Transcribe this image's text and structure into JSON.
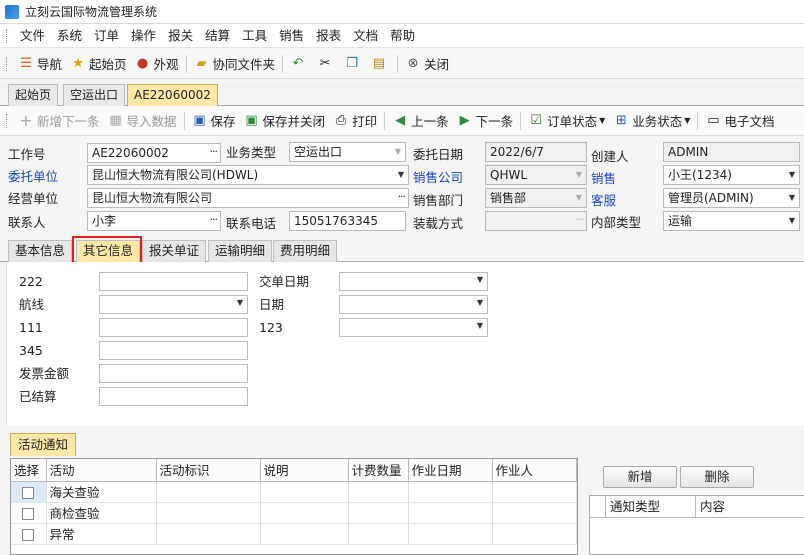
{
  "window": {
    "title": "立刻云国际物流管理系统"
  },
  "menu": [
    "文件",
    "系统",
    "订单",
    "操作",
    "报关",
    "结算",
    "工具",
    "销售",
    "报表",
    "文档",
    "帮助"
  ],
  "toolbar1": {
    "nav": "导航",
    "home": "起始页",
    "appearance": "外观",
    "shared_folder": "协同文件夹",
    "close": "关闭"
  },
  "doc_tabs": [
    "起始页",
    "空运出口",
    "AE22060002"
  ],
  "toolbar2": {
    "add_next": "新增下一条",
    "import": "导入数据",
    "save": "保存",
    "save_close": "保存并关闭",
    "print": "打印",
    "prev": "上一条",
    "next": "下一条",
    "order_status": "订单状态",
    "biz_status": "业务状态",
    "edoc": "电子文档"
  },
  "form": {
    "job_no_label": "工作号",
    "job_no": "AE22060002",
    "biz_type_label": "业务类型",
    "biz_type": "空运出口",
    "entrust_date_label": "委托日期",
    "entrust_date": "2022/6/7",
    "creator_label": "创建人",
    "creator": "ADMIN",
    "client_label": "委托单位",
    "client": "昆山恒大物流有限公司(HDWL)",
    "sales_co_label": "销售公司",
    "sales_co": "QHWL",
    "sales_label": "销售",
    "sales": "小王(1234)",
    "operator_unit_label": "经营单位",
    "operator_unit": "昆山恒大物流有限公司",
    "sales_dept_label": "销售部门",
    "sales_dept": "销售部",
    "cs_label": "客服",
    "cs": "管理员(ADMIN)",
    "contact_label": "联系人",
    "contact": "小李",
    "phone_label": "联系电话",
    "phone": "15051763345",
    "loading_label": "装载方式",
    "loading": "",
    "inner_type_label": "内部类型",
    "inner_type": "运输"
  },
  "sub_tabs": [
    "基本信息",
    "其它信息",
    "报关单证",
    "运输明细",
    "费用明细"
  ],
  "other_info": {
    "f1": "222",
    "f2": "航线",
    "f3": "111",
    "f4": "345",
    "f5": "发票金额",
    "f6": "已结算",
    "g1": "交单日期",
    "g2": "日期",
    "g3": "123"
  },
  "activity": {
    "tab": "活动通知",
    "columns": [
      "选择",
      "活动",
      "活动标识",
      "说明",
      "计费数量",
      "作业日期",
      "作业人"
    ],
    "rows": [
      "海关查验",
      "商检查验",
      "异常"
    ],
    "add": "新增",
    "delete": "删除",
    "notice_columns": [
      "通知类型",
      "内容"
    ]
  }
}
